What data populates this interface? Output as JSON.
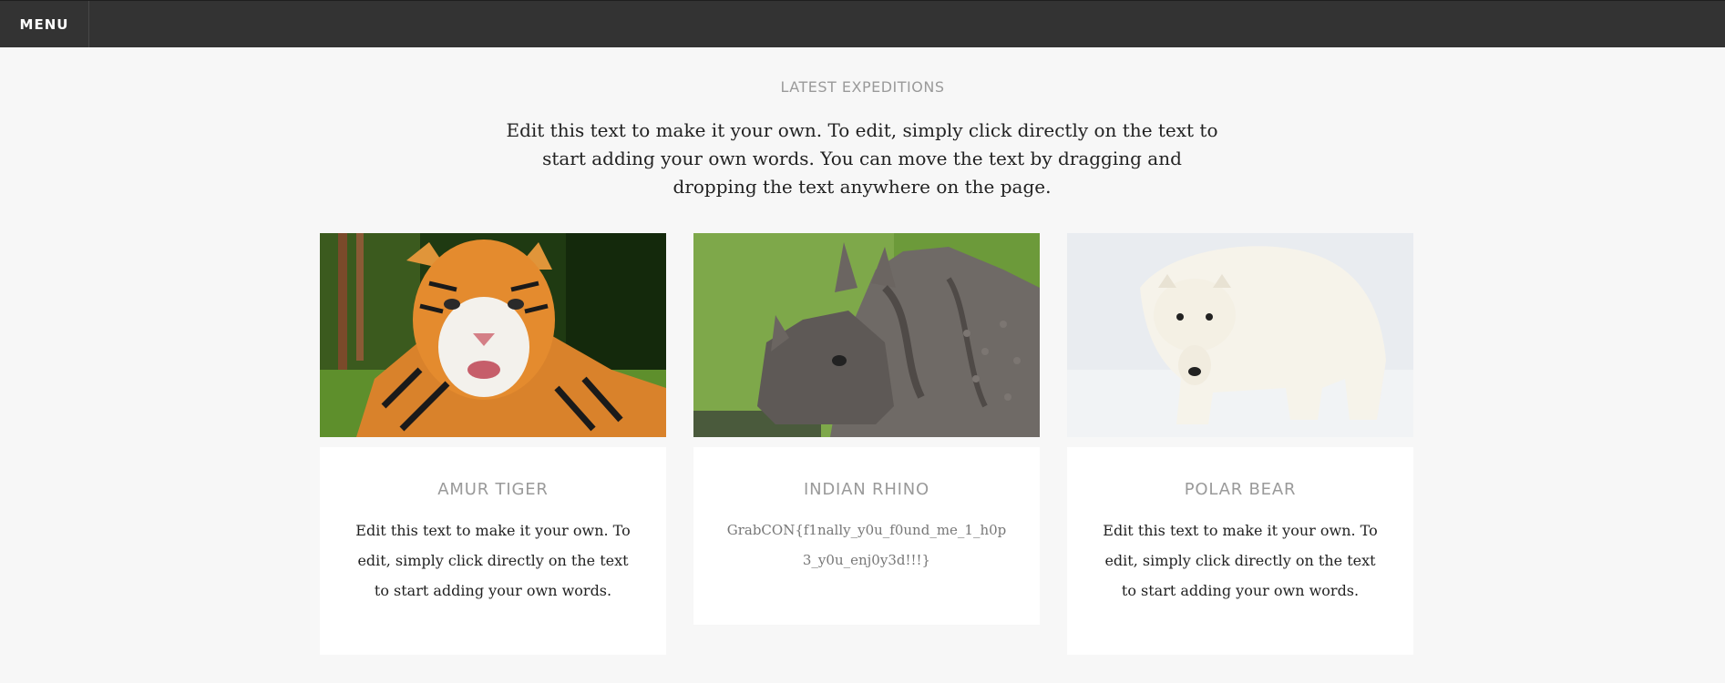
{
  "nav": {
    "menu_label": "MENU"
  },
  "section": {
    "heading": "LATEST EXPEDITIONS",
    "intro": "Edit this text to make it your own. To edit, simply click directly on the text to start adding your own words. You can move the text by dragging and dropping the text anywhere on the page."
  },
  "cards": [
    {
      "title": "AMUR TIGER",
      "text": "Edit this text to make it your own. To edit, simply click directly on the text to start adding your own words."
    },
    {
      "title": "INDIAN RHINO",
      "text": "GrabCON{f1nally_y0u_f0und_me_1_h0p3_y0u_enj0y3d!!!}"
    },
    {
      "title": "POLAR BEAR",
      "text": "Edit this text to make it your own. To edit, simply click directly on the text to start adding your own words."
    }
  ],
  "colors": {
    "topbar": "#333333",
    "background": "#f7f7f7",
    "heading": "#9a9a9a"
  }
}
